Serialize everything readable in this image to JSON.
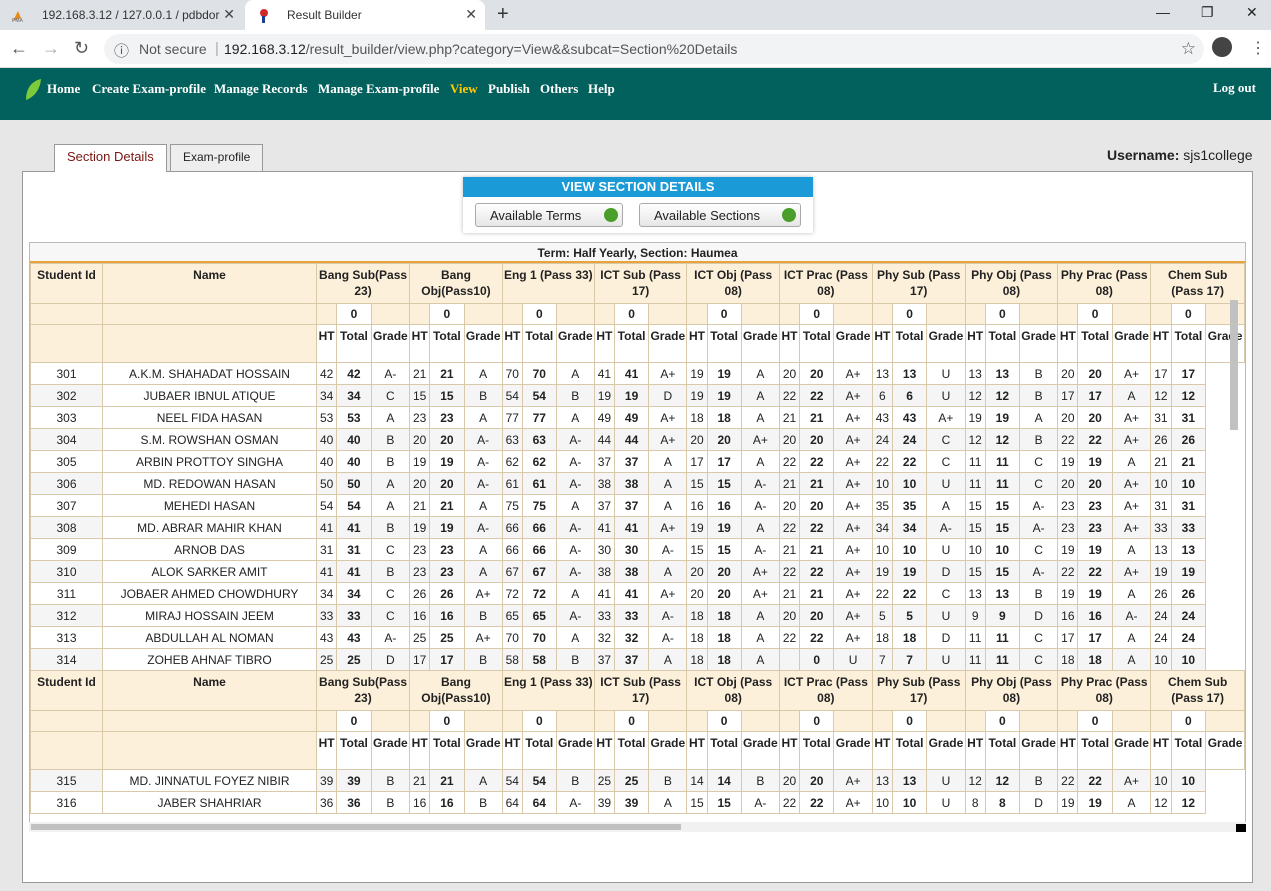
{
  "browser": {
    "tab1_title": "192.168.3.12 / 127.0.0.1 / pdbdor",
    "tab2_title": "Result Builder",
    "not_secure": "Not secure",
    "url_host": "192.168.3.12",
    "url_path": "/result_builder/view.php?category=View&&subcat=Section%20Details"
  },
  "nav": {
    "items": [
      "Home",
      "Create Exam-profile",
      "Manage Records",
      "Manage Exam-profile",
      "View",
      "Publish",
      "Others",
      "Help"
    ],
    "active": "View",
    "logout": "Log out",
    "active_color": "#ffcc00"
  },
  "page_tabs": {
    "tab1": "Section Details",
    "tab2": "Exam-profile"
  },
  "user": {
    "label": "Username:",
    "name": "sjs1college"
  },
  "panel": {
    "title": "VIEW SECTION DETAILS",
    "btn_terms": "Available Terms",
    "btn_sections": "Available Sections"
  },
  "grid": {
    "term_line": "Term: Half Yearly, Section: Haumea",
    "col_student_id": "Student Id",
    "col_name": "Name",
    "subjects": [
      "Bang Sub(Pass 23)",
      "Bang Obj(Pass10)",
      "Eng 1 (Pass 33)",
      "ICT Sub (Pass 17)",
      "ICT Obj (Pass 08)",
      "ICT Prac (Pass 08)",
      "Phy Sub (Pass 17)",
      "Phy Obj (Pass 08)",
      "Phy Prac (Pass 08)",
      "Chem Sub (Pass 17)"
    ],
    "zero": "0",
    "sub_cols": [
      "HT",
      "Total",
      "Grade"
    ],
    "rows_a": [
      [
        "301",
        "A.K.M. SHAHADAT HOSSAIN",
        "42",
        "42",
        "A-",
        "21",
        "21",
        "A",
        "70",
        "70",
        "A",
        "41",
        "41",
        "A+",
        "19",
        "19",
        "A",
        "20",
        "20",
        "A+",
        "13",
        "13",
        "U",
        "13",
        "13",
        "B",
        "20",
        "20",
        "A+",
        "17",
        "17"
      ],
      [
        "302",
        "JUBAER IBNUL ATIQUE",
        "34",
        "34",
        "C",
        "15",
        "15",
        "B",
        "54",
        "54",
        "B",
        "19",
        "19",
        "D",
        "19",
        "19",
        "A",
        "22",
        "22",
        "A+",
        "6",
        "6",
        "U",
        "12",
        "12",
        "B",
        "17",
        "17",
        "A",
        "12",
        "12"
      ],
      [
        "303",
        "NEEL FIDA HASAN",
        "53",
        "53",
        "A",
        "23",
        "23",
        "A",
        "77",
        "77",
        "A",
        "49",
        "49",
        "A+",
        "18",
        "18",
        "A",
        "21",
        "21",
        "A+",
        "43",
        "43",
        "A+",
        "19",
        "19",
        "A",
        "20",
        "20",
        "A+",
        "31",
        "31"
      ],
      [
        "304",
        "S.M. ROWSHAN OSMAN",
        "40",
        "40",
        "B",
        "20",
        "20",
        "A-",
        "63",
        "63",
        "A-",
        "44",
        "44",
        "A+",
        "20",
        "20",
        "A+",
        "20",
        "20",
        "A+",
        "24",
        "24",
        "C",
        "12",
        "12",
        "B",
        "22",
        "22",
        "A+",
        "26",
        "26"
      ],
      [
        "305",
        "ARBIN PROTTOY SINGHA",
        "40",
        "40",
        "B",
        "19",
        "19",
        "A-",
        "62",
        "62",
        "A-",
        "37",
        "37",
        "A",
        "17",
        "17",
        "A",
        "22",
        "22",
        "A+",
        "22",
        "22",
        "C",
        "11",
        "11",
        "C",
        "19",
        "19",
        "A",
        "21",
        "21"
      ],
      [
        "306",
        "MD. REDOWAN HASAN",
        "50",
        "50",
        "A",
        "20",
        "20",
        "A-",
        "61",
        "61",
        "A-",
        "38",
        "38",
        "A",
        "15",
        "15",
        "A-",
        "21",
        "21",
        "A+",
        "10",
        "10",
        "U",
        "11",
        "11",
        "C",
        "20",
        "20",
        "A+",
        "10",
        "10"
      ],
      [
        "307",
        "MEHEDI HASAN",
        "54",
        "54",
        "A",
        "21",
        "21",
        "A",
        "75",
        "75",
        "A",
        "37",
        "37",
        "A",
        "16",
        "16",
        "A-",
        "20",
        "20",
        "A+",
        "35",
        "35",
        "A",
        "15",
        "15",
        "A-",
        "23",
        "23",
        "A+",
        "31",
        "31"
      ],
      [
        "308",
        "MD. ABRAR MAHIR KHAN",
        "41",
        "41",
        "B",
        "19",
        "19",
        "A-",
        "66",
        "66",
        "A-",
        "41",
        "41",
        "A+",
        "19",
        "19",
        "A",
        "22",
        "22",
        "A+",
        "34",
        "34",
        "A-",
        "15",
        "15",
        "A-",
        "23",
        "23",
        "A+",
        "33",
        "33"
      ],
      [
        "309",
        "ARNOB DAS",
        "31",
        "31",
        "C",
        "23",
        "23",
        "A",
        "66",
        "66",
        "A-",
        "30",
        "30",
        "A-",
        "15",
        "15",
        "A-",
        "21",
        "21",
        "A+",
        "10",
        "10",
        "U",
        "10",
        "10",
        "C",
        "19",
        "19",
        "A",
        "13",
        "13"
      ],
      [
        "310",
        "ALOK SARKER AMIT",
        "41",
        "41",
        "B",
        "23",
        "23",
        "A",
        "67",
        "67",
        "A-",
        "38",
        "38",
        "A",
        "20",
        "20",
        "A+",
        "22",
        "22",
        "A+",
        "19",
        "19",
        "D",
        "15",
        "15",
        "A-",
        "22",
        "22",
        "A+",
        "19",
        "19"
      ],
      [
        "311",
        "JOBAER AHMED CHOWDHURY",
        "34",
        "34",
        "C",
        "26",
        "26",
        "A+",
        "72",
        "72",
        "A",
        "41",
        "41",
        "A+",
        "20",
        "20",
        "A+",
        "21",
        "21",
        "A+",
        "22",
        "22",
        "C",
        "13",
        "13",
        "B",
        "19",
        "19",
        "A",
        "26",
        "26"
      ],
      [
        "312",
        "MIRAJ HOSSAIN JEEM",
        "33",
        "33",
        "C",
        "16",
        "16",
        "B",
        "65",
        "65",
        "A-",
        "33",
        "33",
        "A-",
        "18",
        "18",
        "A",
        "20",
        "20",
        "A+",
        "5",
        "5",
        "U",
        "9",
        "9",
        "D",
        "16",
        "16",
        "A-",
        "24",
        "24"
      ],
      [
        "313",
        "ABDULLAH AL NOMAN",
        "43",
        "43",
        "A-",
        "25",
        "25",
        "A+",
        "70",
        "70",
        "A",
        "32",
        "32",
        "A-",
        "18",
        "18",
        "A",
        "22",
        "22",
        "A+",
        "18",
        "18",
        "D",
        "11",
        "11",
        "C",
        "17",
        "17",
        "A",
        "24",
        "24"
      ],
      [
        "314",
        "ZOHEB AHNAF TIBRO",
        "25",
        "25",
        "D",
        "17",
        "17",
        "B",
        "58",
        "58",
        "B",
        "37",
        "37",
        "A",
        "18",
        "18",
        "A",
        "",
        "0",
        "U",
        "7",
        "7",
        "U",
        "11",
        "11",
        "C",
        "18",
        "18",
        "A",
        "10",
        "10"
      ]
    ],
    "rows_b": [
      [
        "315",
        "MD. JINNATUL FOYEZ NIBIR",
        "39",
        "39",
        "B",
        "21",
        "21",
        "A",
        "54",
        "54",
        "B",
        "25",
        "25",
        "B",
        "14",
        "14",
        "B",
        "20",
        "20",
        "A+",
        "13",
        "13",
        "U",
        "12",
        "12",
        "B",
        "22",
        "22",
        "A+",
        "10",
        "10"
      ],
      [
        "316",
        "JABER SHAHRIAR",
        "36",
        "36",
        "B",
        "16",
        "16",
        "B",
        "64",
        "64",
        "A-",
        "39",
        "39",
        "A",
        "15",
        "15",
        "A-",
        "22",
        "22",
        "A+",
        "10",
        "10",
        "U",
        "8",
        "8",
        "D",
        "19",
        "19",
        "A",
        "12",
        "12"
      ]
    ]
  }
}
